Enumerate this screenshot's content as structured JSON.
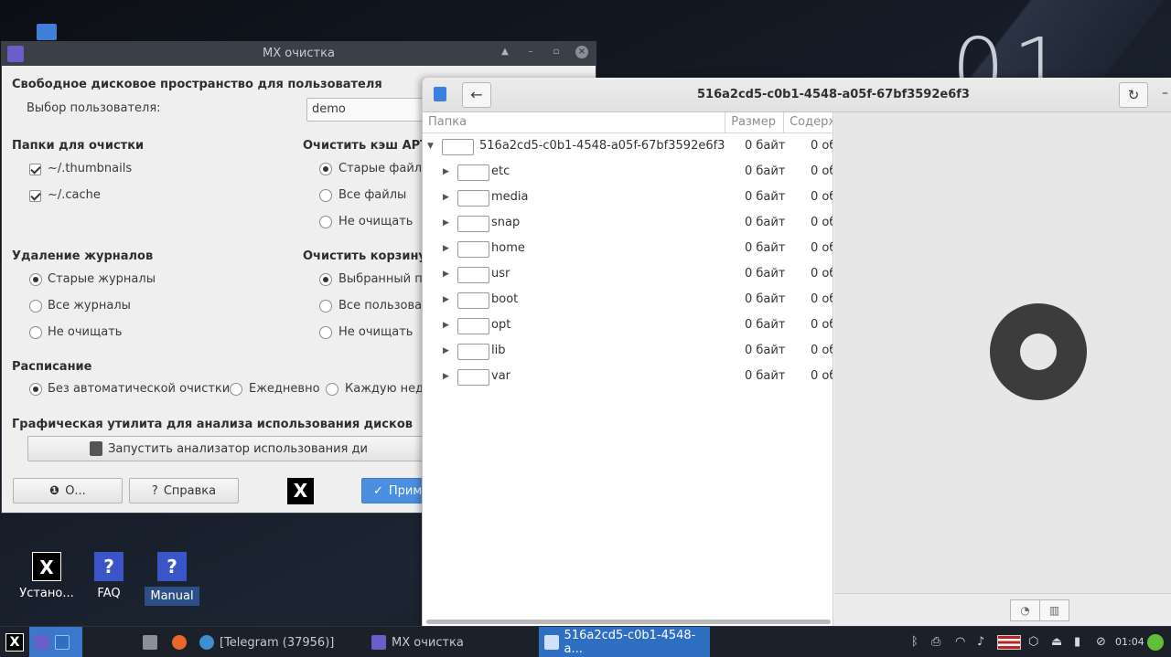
{
  "desktop": {
    "clock_big": "01",
    "icons": [
      {
        "label": "Устано..."
      },
      {
        "label": "FAQ"
      },
      {
        "label": "Manual"
      }
    ]
  },
  "cleanup": {
    "title": "MX очистка",
    "free_space_heading": "Свободное дисковое пространство для пользователя",
    "user_select_label": "Выбор пользователя:",
    "user_value": "demo",
    "folders_heading": "Папки для очистки",
    "folders": [
      "~/.thumbnails",
      "~/.cache"
    ],
    "apt_heading": "Очистить кэш APT",
    "apt_options": [
      "Старые файлы",
      "Все файлы",
      "Не очищать"
    ],
    "logs_heading": "Удаление журналов",
    "logs_options": [
      "Старые журналы",
      "Все журналы",
      "Не очищать"
    ],
    "trash_heading": "Очистить корзину",
    "trash_options": [
      "Выбранный по",
      "Все пользоват",
      "Не очищать"
    ],
    "schedule_heading": "Расписание",
    "schedule_options": [
      "Без автоматической очистки",
      "Ежедневно",
      "Каждую неде"
    ],
    "analyzer_heading": "Графическая утилита для анализа использования дисков",
    "analyzer_button": "Запустить анализатор использования ди",
    "about_button": "О...",
    "help_button": "Справка",
    "apply_button": "Прим"
  },
  "disk_usage": {
    "title": "516a2cd5-c0b1-4548-a05f-67bf3592e6f3",
    "columns": {
      "folder": "Папка",
      "size": "Размер",
      "contents": "Содерж"
    },
    "root": {
      "name": "516a2cd5-c0b1-4548-a05f-67bf3592e6f3",
      "size": "0 байт",
      "contents": "0 об"
    },
    "rows": [
      {
        "name": "etc",
        "size": "0 байт",
        "contents": "0 об"
      },
      {
        "name": "media",
        "size": "0 байт",
        "contents": "0 об"
      },
      {
        "name": "snap",
        "size": "0 байт",
        "contents": "0 об"
      },
      {
        "name": "home",
        "size": "0 байт",
        "contents": "0 об"
      },
      {
        "name": "usr",
        "size": "0 байт",
        "contents": "0 об"
      },
      {
        "name": "boot",
        "size": "0 байт",
        "contents": "0 об"
      },
      {
        "name": "opt",
        "size": "0 байт",
        "contents": "0 об"
      },
      {
        "name": "lib",
        "size": "0 байт",
        "contents": "0 об"
      },
      {
        "name": "var",
        "size": "0 байт",
        "contents": "0 об"
      }
    ]
  },
  "taskbar": {
    "tasks": [
      "[Telegram (37956)]",
      "MX очистка",
      "516a2cd5-c0b1-4548-a..."
    ],
    "time": "01:04"
  }
}
